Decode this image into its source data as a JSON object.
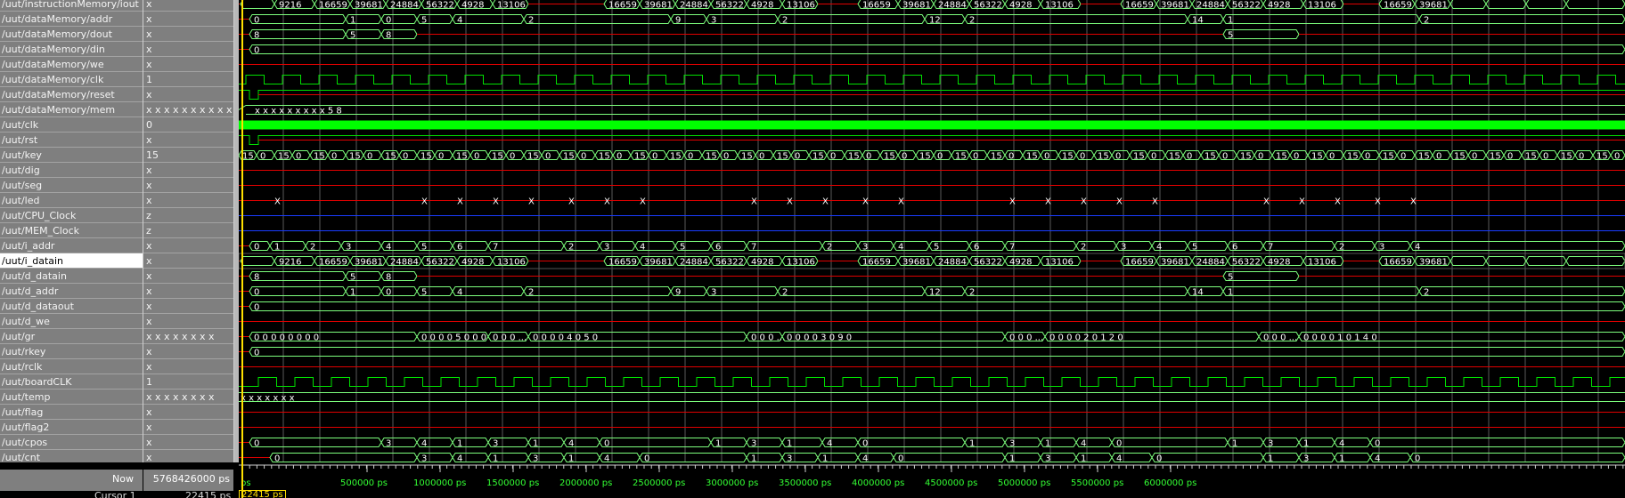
{
  "signals": [
    {
      "name": "/uut/instructionMemory/iout",
      "value": "x"
    },
    {
      "name": "/uut/dataMemory/addr",
      "value": "x"
    },
    {
      "name": "/uut/dataMemory/dout",
      "value": "x"
    },
    {
      "name": "/uut/dataMemory/din",
      "value": "x"
    },
    {
      "name": "/uut/dataMemory/we",
      "value": "x"
    },
    {
      "name": "/uut/dataMemory/clk",
      "value": "1"
    },
    {
      "name": "/uut/dataMemory/reset",
      "value": "x"
    },
    {
      "name": "/uut/dataMemory/mem",
      "value": "x x x x x x x x x x"
    },
    {
      "name": "/uut/clk",
      "value": "0"
    },
    {
      "name": "/uut/rst",
      "value": "x"
    },
    {
      "name": "/uut/key",
      "value": "15"
    },
    {
      "name": "/uut/dig",
      "value": "x"
    },
    {
      "name": "/uut/seg",
      "value": "x"
    },
    {
      "name": "/uut/led",
      "value": "x"
    },
    {
      "name": "/uut/CPU_Clock",
      "value": "z"
    },
    {
      "name": "/uut/MEM_Clock",
      "value": "z"
    },
    {
      "name": "/uut/i_addr",
      "value": "x"
    },
    {
      "name": "/uut/i_datain",
      "value": "x"
    },
    {
      "name": "/uut/d_datain",
      "value": "x"
    },
    {
      "name": "/uut/d_addr",
      "value": "x"
    },
    {
      "name": "/uut/d_dataout",
      "value": "x"
    },
    {
      "name": "/uut/d_we",
      "value": "x"
    },
    {
      "name": "/uut/gr",
      "value": "x x x x x x x x"
    },
    {
      "name": "/uut/rkey",
      "value": "x"
    },
    {
      "name": "/uut/rclk",
      "value": "x"
    },
    {
      "name": "/uut/boardCLK",
      "value": "1"
    },
    {
      "name": "/uut/temp",
      "value": "x x x x x x x x"
    },
    {
      "name": "/uut/flag",
      "value": "x"
    },
    {
      "name": "/uut/flag2",
      "value": "x"
    },
    {
      "name": "/uut/cpos",
      "value": "x"
    },
    {
      "name": "/uut/cnt",
      "value": "x"
    }
  ],
  "selected_signal": 17,
  "footer": {
    "now_label": "Now",
    "now_value": "5768426000 ps",
    "cursor_label": "Cursor 1",
    "cursor_value": "22415 ps",
    "cursor_badge": "22415 ps",
    "ruler_start": "ps",
    "ruler_labels": [
      "500000 ps",
      "1000000 ps",
      "1500000 ps",
      "2000000 ps",
      "2500000 ps",
      "3000000 ps",
      "3500000 ps",
      "4000000 ps",
      "4500000 ps",
      "5000000 ps",
      "5500000 ps",
      "6000000 ps"
    ]
  },
  "waves": {
    "iout": {
      "trans": [
        2,
        40,
        85,
        125,
        165,
        205,
        245,
        285,
        325,
        410,
        450,
        490,
        530,
        570,
        610,
        650,
        695,
        740,
        780,
        820,
        860,
        900,
        945,
        990,
        1030,
        1070,
        1110,
        1150,
        1195,
        1240,
        1280,
        1320,
        1360,
        1400,
        1445,
        1490
      ],
      "labels": [
        "",
        "9216",
        "16659",
        "39681",
        "24884",
        "56322",
        "4928",
        "13106",
        "",
        "16659",
        "39681",
        "24884",
        "56322",
        "4928",
        "13106",
        "",
        "16659",
        "39681",
        "24884",
        "56322",
        "4928",
        "13106",
        "",
        "16659",
        "39681",
        "24884",
        "56322",
        "4928",
        "13106",
        "",
        "16659",
        "39681"
      ]
    },
    "mem_addr": {
      "trans": [
        12,
        120,
        160,
        200,
        240,
        320,
        485,
        525,
        605,
        770,
        815,
        1065,
        1105,
        1325
      ],
      "labels": [
        "0",
        "1",
        "0",
        "5",
        "4",
        "2",
        "9",
        "3",
        "2",
        "12",
        "2",
        "14",
        "1",
        "2"
      ]
    },
    "mem_dout": {
      "trans": [
        12,
        120,
        160,
        200,
        1105,
        1190
      ],
      "labels": [
        "8",
        "5",
        "8",
        "",
        "5",
        ""
      ]
    },
    "mem_din": {
      "trans": [
        12
      ],
      "labels": [
        "0"
      ]
    },
    "mem_mem": {
      "text": "x x x x x x x x x 5 8"
    },
    "key": {
      "period": 20,
      "labels": [
        "15",
        "0"
      ]
    },
    "led_x": [
      40,
      205,
      245,
      285,
      325,
      370,
      410,
      450,
      575,
      615,
      655,
      700,
      740,
      865,
      905,
      945,
      985,
      1025,
      1150,
      1190,
      1230,
      1275,
      1315
    ],
    "i_addr": {
      "trans": [
        12,
        35,
        75,
        115,
        160,
        200,
        240,
        280,
        365,
        405,
        445,
        490,
        530,
        570,
        655,
        695,
        735,
        775,
        820,
        860,
        940,
        985,
        1025,
        1065,
        1110,
        1150,
        1230,
        1275,
        1315
      ],
      "labels": [
        "0",
        "1",
        "2",
        "3",
        "4",
        "5",
        "6",
        "7",
        "2",
        "3",
        "4",
        "5",
        "6",
        "7",
        "2",
        "3",
        "4",
        "5",
        "6",
        "7",
        "2",
        "3",
        "4",
        "5",
        "6",
        "7",
        "2",
        "3",
        "4"
      ]
    },
    "d_datain": {
      "trans": [
        12,
        120,
        160,
        200,
        1105,
        1190
      ],
      "labels": [
        "8",
        "5",
        "8",
        "",
        "5",
        ""
      ]
    },
    "d_addr": {
      "trans": [
        12,
        120,
        160,
        200,
        240,
        320,
        485,
        525,
        605,
        770,
        815,
        1065,
        1105,
        1325
      ],
      "labels": [
        "0",
        "1",
        "0",
        "5",
        "4",
        "2",
        "9",
        "3",
        "2",
        "12",
        "2",
        "14",
        "1",
        "2"
      ]
    },
    "d_dataout": {
      "trans": [
        12
      ],
      "labels": [
        "0"
      ]
    },
    "gr": {
      "trans": [
        12,
        200,
        280,
        325,
        570,
        610,
        860,
        905,
        1145,
        1190
      ],
      "labels": [
        "0 0 0 0 0 0 0 0",
        "0 0 0 0 5 0 0 0",
        "0 0 0 ...",
        "0 0 0 0 4 0 5 0",
        "0 0 0 ...",
        "0 0 0 0 3 0 9 0",
        "0 0 0 ...",
        "0 0 0 0 2 0 1 2 0",
        "0 0 0 ...",
        "0 0 0 0 1 0 1 4 0"
      ]
    },
    "rkey": {
      "trans": [
        12
      ],
      "labels": [
        "0"
      ]
    },
    "temp": {
      "text": "x x x x x x x"
    },
    "cpos": {
      "trans": [
        12,
        160,
        200,
        240,
        280,
        325,
        365,
        405,
        530,
        570,
        610,
        655,
        695,
        815,
        860,
        900,
        940,
        980,
        1110,
        1150,
        1190,
        1230,
        1270
      ],
      "labels": [
        "0",
        "3",
        "4",
        "1",
        "3",
        "1",
        "4",
        "0",
        "1",
        "3",
        "1",
        "4",
        "0",
        "1",
        "3",
        "1",
        "4",
        "0",
        "1",
        "3",
        "1",
        "4",
        "0"
      ]
    },
    "cnt": {
      "trans": [
        35,
        200,
        240,
        280,
        325,
        365,
        405,
        450,
        570,
        610,
        650,
        695,
        735,
        860,
        900,
        940,
        980,
        1025,
        1150,
        1190,
        1230,
        1270,
        1315
      ],
      "labels": [
        "0",
        "3",
        "4",
        "1",
        "3",
        "1",
        "4",
        "0",
        "1",
        "3",
        "1",
        "4",
        "0",
        "1",
        "3",
        "1",
        "4",
        "0",
        "1",
        "3",
        "1",
        "4",
        "0"
      ]
    }
  },
  "colors": {
    "bus": "#7dff7d",
    "x_red": "#e00000",
    "z_blue": "#1a3cff",
    "clk": "#00e000",
    "grid": "#5a5a5a",
    "cursor": "#ffe000",
    "ruler_text": "#33ff33"
  }
}
